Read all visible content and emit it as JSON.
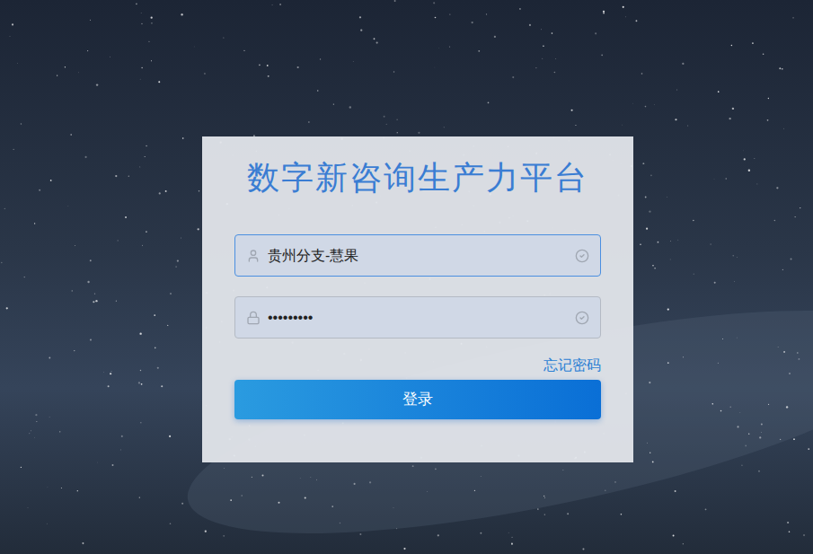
{
  "title": "数字新咨询生产力平台",
  "fields": [
    {
      "kind": "text",
      "value": "贵州分支-慧果",
      "focused": true,
      "valid": true
    },
    {
      "kind": "password",
      "value": "•••••••••",
      "focused": false,
      "valid": true
    }
  ],
  "forgot_link": "忘记密码",
  "login_button": "登录"
}
